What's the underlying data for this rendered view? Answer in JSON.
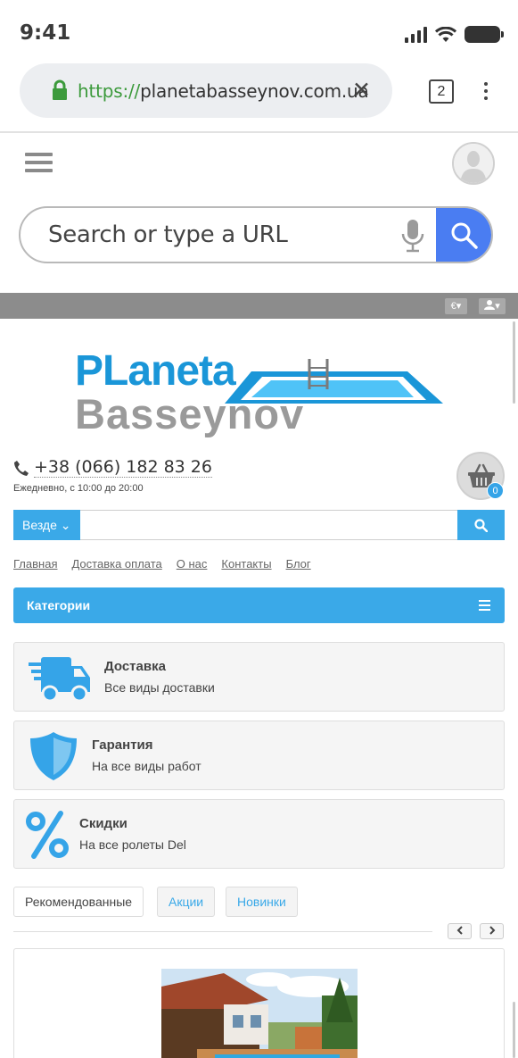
{
  "status_bar": {
    "time": "9:41"
  },
  "browser": {
    "url_scheme": "https://",
    "url_host": "planetabasseynov.com.ua",
    "tab_count": "2",
    "search_placeholder": "Search or type a URL"
  },
  "site": {
    "currency_label": "€",
    "logo": {
      "line1": "PLaneta",
      "line2": "Basseynov"
    },
    "phone": "+38 (066) 182 83 26",
    "hours": "Ежедневно, с 10:00 до 20:00",
    "cart_count": "0",
    "search_scope": "Везде",
    "nav": [
      "Главная",
      "Доставка оплата",
      "О нас",
      "Контакты",
      "Блог"
    ],
    "categories_label": "Категории",
    "features": [
      {
        "title": "Доставка",
        "subtitle": "Все виды доставки",
        "icon": "truck-icon"
      },
      {
        "title": "Гарантия",
        "subtitle": "На все виды работ",
        "icon": "shield-icon"
      },
      {
        "title": "Скидки",
        "subtitle": "На все ролеты Del",
        "icon": "percent-icon"
      }
    ],
    "product_tabs": [
      "Рекомендованные",
      "Акции",
      "Новинки"
    ],
    "colors": {
      "accent": "#3aa9e8",
      "logo_blue": "#1a96d8",
      "logo_gray": "#9a9a9a",
      "browser_go": "#4a7df2"
    }
  }
}
